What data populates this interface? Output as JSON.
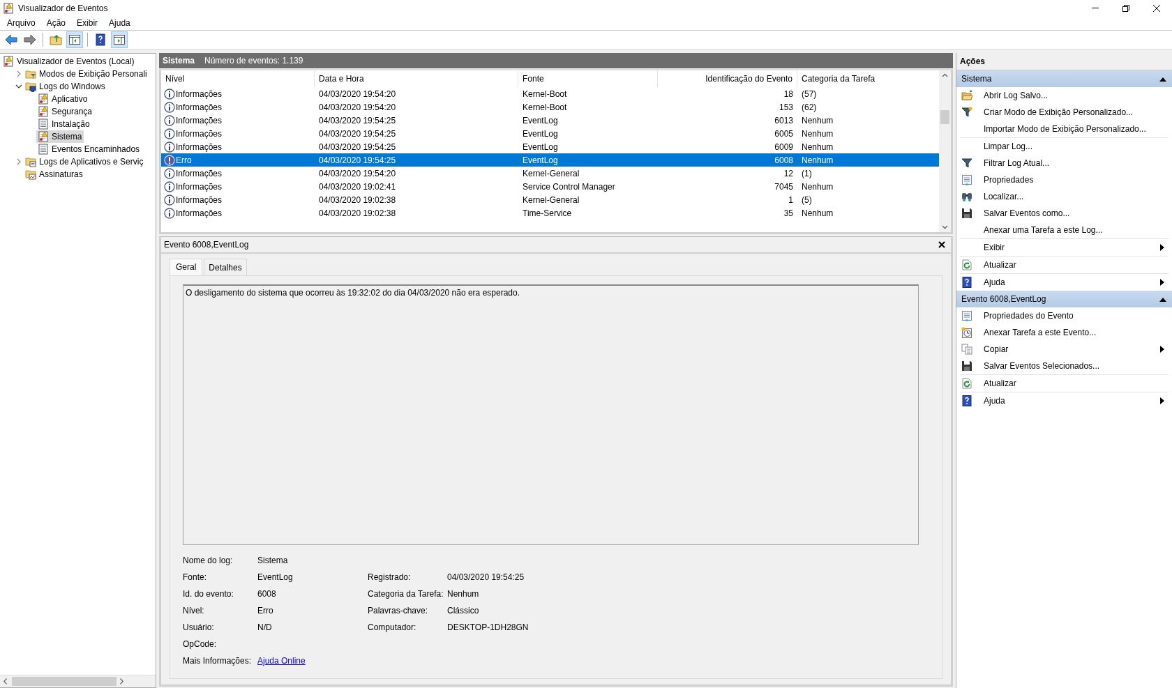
{
  "window": {
    "title": "Visualizador de Eventos"
  },
  "menu": [
    "Arquivo",
    "Ação",
    "Exibir",
    "Ajuda"
  ],
  "toolbar": [
    {
      "kind": "back"
    },
    {
      "kind": "forward"
    },
    {
      "kind": "sep"
    },
    {
      "kind": "folder"
    },
    {
      "kind": "pane-left",
      "selected": true
    },
    {
      "kind": "sep"
    },
    {
      "kind": "help"
    },
    {
      "kind": "pane-right",
      "selected": true
    }
  ],
  "tree": [
    {
      "label": "Visualizador de Eventos (Local)",
      "kind": "viewer",
      "selected": false,
      "children": [
        {
          "label": "Modos de Exibição Personali",
          "kind": "folder-filter",
          "expanded": false,
          "selected": false
        },
        {
          "label": "Logs do Windows",
          "kind": "folder-pc",
          "expanded": true,
          "selected": false,
          "children": [
            {
              "label": "Aplicativo",
              "kind": "log-warn",
              "selected": false
            },
            {
              "label": "Segurança",
              "kind": "log-warn",
              "selected": false
            },
            {
              "label": "Instalação",
              "kind": "log",
              "selected": false
            },
            {
              "label": "Sistema",
              "kind": "log-warn",
              "selected": true
            },
            {
              "label": "Eventos Encaminhados",
              "kind": "log",
              "selected": false
            }
          ]
        },
        {
          "label": "Logs de Aplicativos e Serviç",
          "kind": "folder-log",
          "expanded": false,
          "selected": false
        },
        {
          "label": "Assinaturas",
          "kind": "subs",
          "selected": false
        }
      ]
    }
  ],
  "log_header": {
    "name": "Sistema",
    "count": "Número de eventos: 1.139"
  },
  "table": {
    "columns": [
      "Nível",
      "Data e Hora",
      "Fonte",
      "Identificação do Evento",
      "Categoria da Tarefa"
    ],
    "rows": [
      {
        "kind": "info",
        "level": "Informações",
        "date": "04/03/2020 19:54:20",
        "source": "Kernel-Boot",
        "id": "18",
        "category": "(57)",
        "selected": false
      },
      {
        "kind": "info",
        "level": "Informações",
        "date": "04/03/2020 19:54:20",
        "source": "Kernel-Boot",
        "id": "153",
        "category": "(62)",
        "selected": false
      },
      {
        "kind": "info",
        "level": "Informações",
        "date": "04/03/2020 19:54:25",
        "source": "EventLog",
        "id": "6013",
        "category": "Nenhum",
        "selected": false
      },
      {
        "kind": "info",
        "level": "Informações",
        "date": "04/03/2020 19:54:25",
        "source": "EventLog",
        "id": "6005",
        "category": "Nenhum",
        "selected": false
      },
      {
        "kind": "info",
        "level": "Informações",
        "date": "04/03/2020 19:54:25",
        "source": "EventLog",
        "id": "6009",
        "category": "Nenhum",
        "selected": false
      },
      {
        "kind": "error",
        "level": "Erro",
        "date": "04/03/2020 19:54:25",
        "source": "EventLog",
        "id": "6008",
        "category": "Nenhum",
        "selected": true
      },
      {
        "kind": "info",
        "level": "Informações",
        "date": "04/03/2020 19:54:20",
        "source": "Kernel-General",
        "id": "12",
        "category": "(1)",
        "selected": false
      },
      {
        "kind": "info",
        "level": "Informações",
        "date": "04/03/2020 19:02:41",
        "source": "Service Control Manager",
        "id": "7045",
        "category": "Nenhum",
        "selected": false
      },
      {
        "kind": "info",
        "level": "Informações",
        "date": "04/03/2020 19:02:38",
        "source": "Kernel-General",
        "id": "1",
        "category": "(5)",
        "selected": false
      },
      {
        "kind": "info",
        "level": "Informações",
        "date": "04/03/2020 19:02:38",
        "source": "Time-Service",
        "id": "35",
        "category": "Nenhum",
        "selected": false
      }
    ]
  },
  "details": {
    "title": "Evento 6008,EventLog",
    "tabs": [
      {
        "label": "Geral",
        "selected": true
      },
      {
        "label": "Detalhes",
        "selected": false
      }
    ],
    "message": "O desligamento do sistema que ocorreu às 19:32:02 do dia 04/03/2020 não era esperado.",
    "fields": [
      [
        {
          "label": "Nome do log:",
          "value": "Sistema"
        }
      ],
      [
        {
          "label": "Fonte:",
          "value": "EventLog"
        },
        {
          "label": "Registrado:",
          "value": "04/03/2020 19:54:25"
        }
      ],
      [
        {
          "label": "Id. do evento:",
          "value": "6008"
        },
        {
          "label": "Categoria da Tarefa:",
          "value": "Nenhum"
        }
      ],
      [
        {
          "label": "Nível:",
          "value": "Erro"
        },
        {
          "label": "Palavras-chave:",
          "value": "Clássico"
        }
      ],
      [
        {
          "label": "Usuário:",
          "value": "N/D"
        },
        {
          "label": "Computador:",
          "value": "DESKTOP-1DH28GN"
        }
      ],
      [
        {
          "label": "OpCode:"
        }
      ],
      [
        {
          "label": "Mais Informações:",
          "link": "Ajuda Online"
        }
      ]
    ]
  },
  "actions": {
    "title": "Ações",
    "sections": [
      {
        "title": "Sistema",
        "expanded": true,
        "items": [
          {
            "label": "Abrir Log Salvo...",
            "kind": "folder",
            "submenu": false,
            "separator": false
          },
          {
            "label": "Criar Modo de Exibição Personalizado...",
            "kind": "filter-star",
            "submenu": false,
            "separator": false
          },
          {
            "label": "Importar Modo de Exibição Personalizado...",
            "kind": "plain",
            "submenu": false,
            "separator": true
          },
          {
            "label": "Limpar Log...",
            "kind": "plain",
            "submenu": false,
            "separator": false
          },
          {
            "label": "Filtrar Log Atual...",
            "kind": "filter",
            "submenu": false,
            "separator": false
          },
          {
            "label": "Propriedades",
            "kind": "props",
            "submenu": false,
            "separator": false
          },
          {
            "label": "Localizar...",
            "kind": "binoculars",
            "submenu": false,
            "separator": false
          },
          {
            "label": "Salvar Eventos como...",
            "kind": "save",
            "submenu": false,
            "separator": false
          },
          {
            "label": "Anexar uma Tarefa a este Log...",
            "kind": "plain",
            "submenu": false,
            "separator": true
          },
          {
            "label": "Exibir",
            "kind": "plain",
            "submenu": true,
            "separator": true
          },
          {
            "label": "Atualizar",
            "kind": "refresh",
            "submenu": false,
            "separator": true
          },
          {
            "label": "Ajuda",
            "kind": "help",
            "submenu": true,
            "separator": false
          }
        ]
      },
      {
        "title": "Evento 6008,EventLog",
        "expanded": true,
        "items": [
          {
            "label": "Propriedades do Evento",
            "kind": "props",
            "submenu": false,
            "separator": false
          },
          {
            "label": "Anexar Tarefa a este Evento...",
            "kind": "clock",
            "submenu": false,
            "separator": false
          },
          {
            "label": "Copiar",
            "kind": "copy",
            "submenu": true,
            "separator": false
          },
          {
            "label": "Salvar Eventos Selecionados...",
            "kind": "save",
            "submenu": false,
            "separator": true
          },
          {
            "label": "Atualizar",
            "kind": "refresh",
            "submenu": false,
            "separator": true
          },
          {
            "label": "Ajuda",
            "kind": "help",
            "submenu": true,
            "separator": false
          }
        ]
      }
    ]
  }
}
